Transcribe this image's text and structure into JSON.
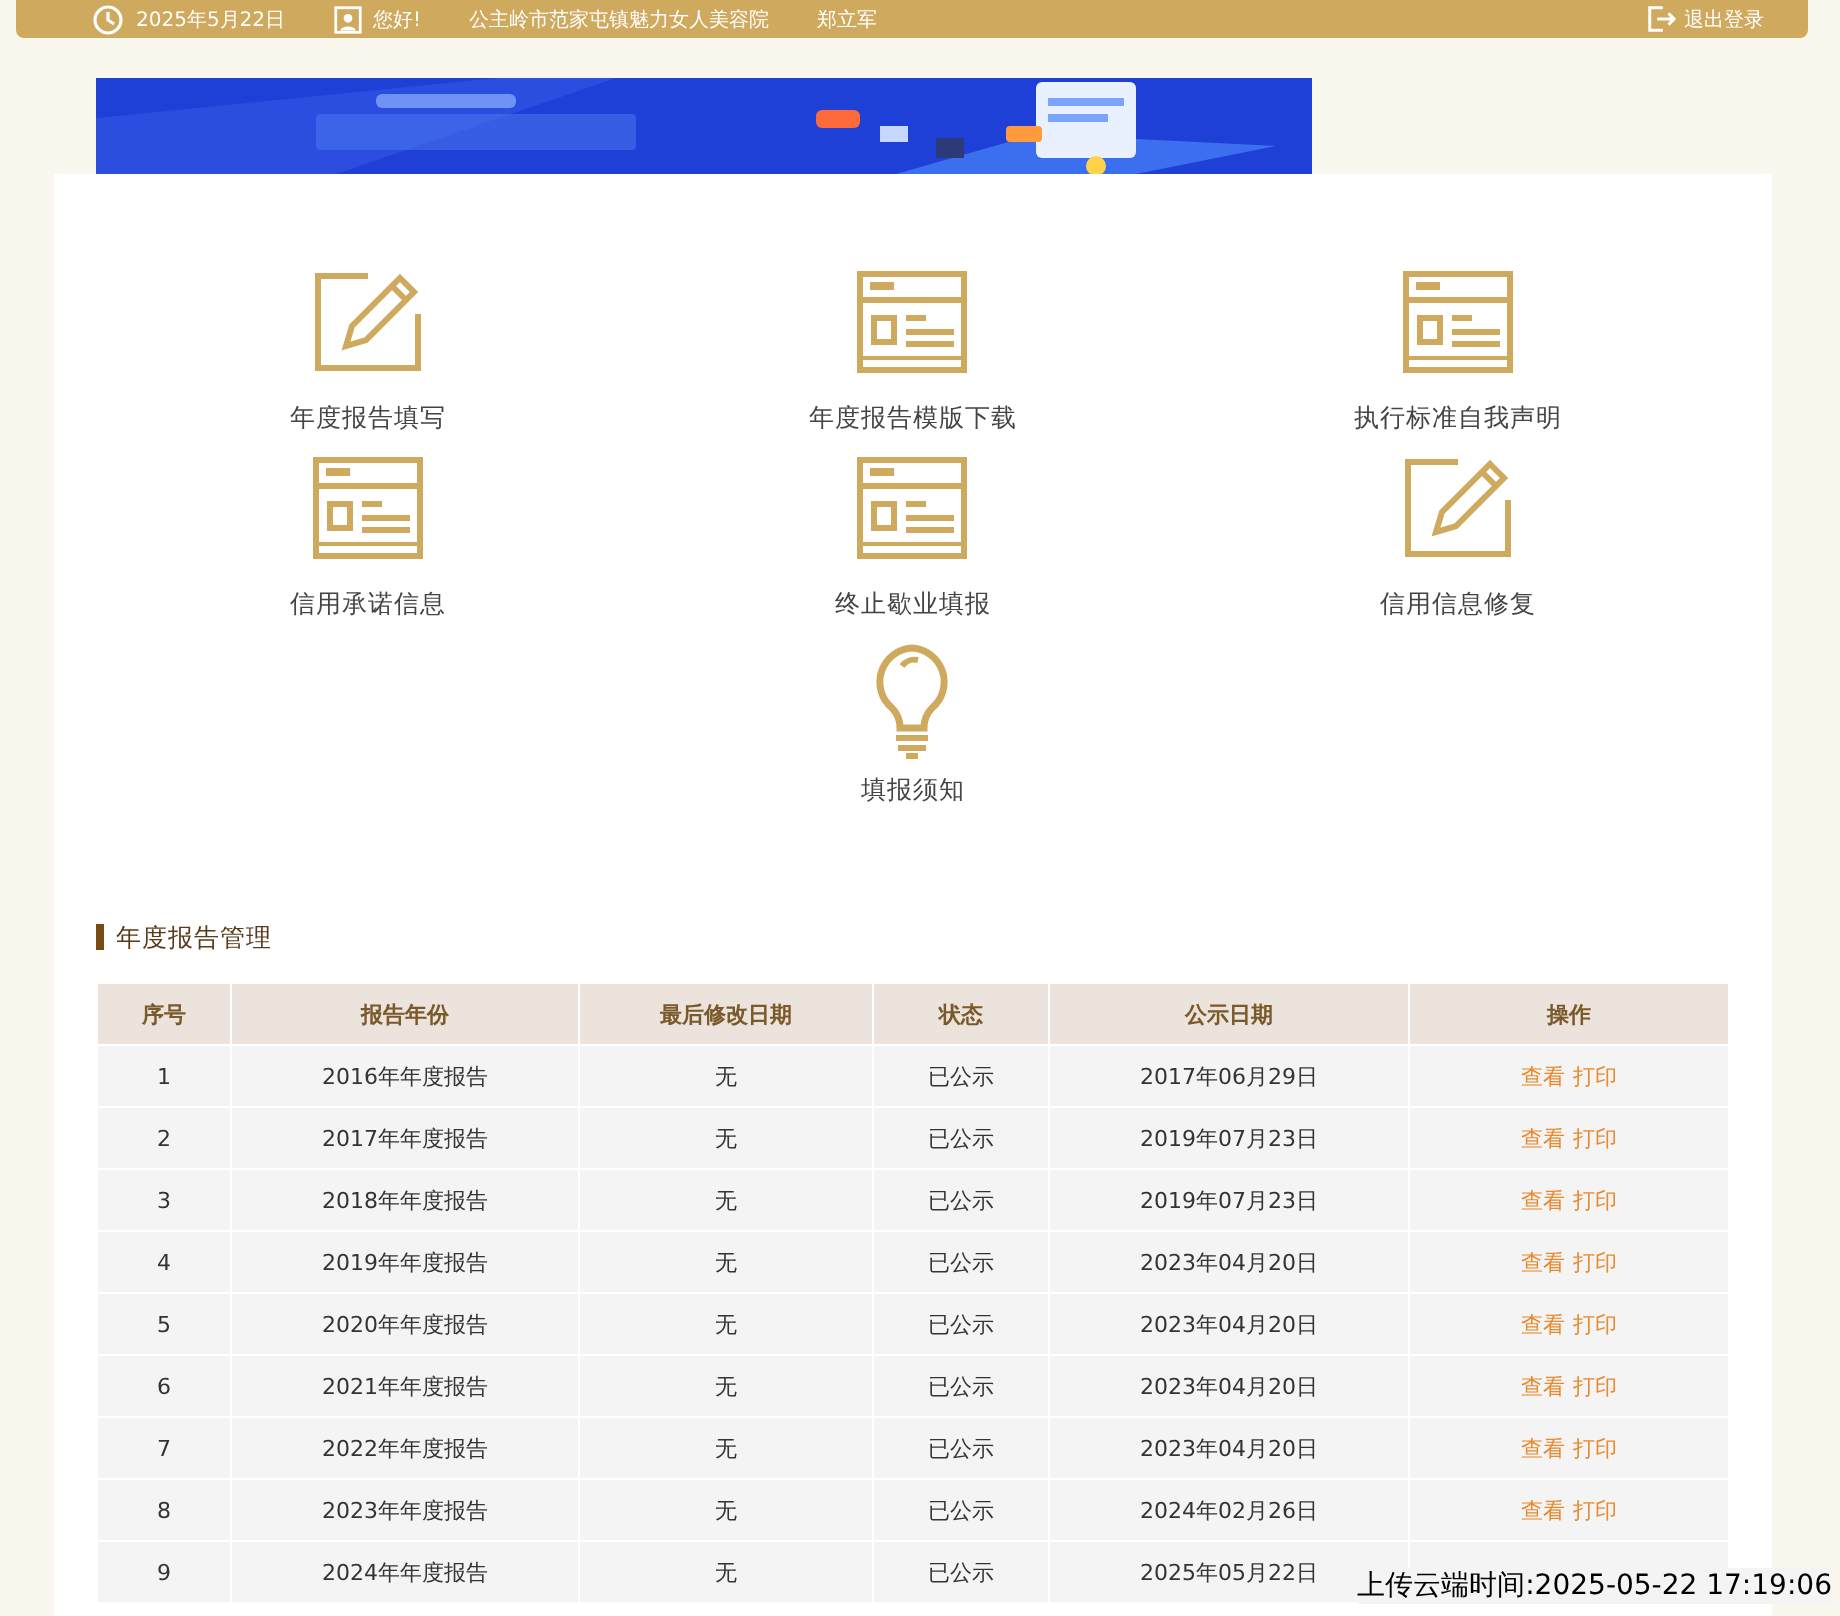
{
  "top_bar": {
    "date": "2025年5月22日",
    "greeting": "您好!",
    "company": "公主岭市范家屯镇魅力女人美容院",
    "user": "郑立军",
    "logout": "退出登录"
  },
  "shortcuts": [
    {
      "kind": "edit",
      "label": "年度报告填写"
    },
    {
      "kind": "form",
      "label": "年度报告模版下载"
    },
    {
      "kind": "form",
      "label": "执行标准自我声明"
    },
    {
      "kind": "form",
      "label": "信用承诺信息"
    },
    {
      "kind": "form",
      "label": "终止歇业填报"
    },
    {
      "kind": "edit",
      "label": "信用信息修复"
    },
    {
      "kind": "bulb",
      "label": "填报须知"
    }
  ],
  "section_title": "年度报告管理",
  "table": {
    "columns": [
      "序号",
      "报告年份",
      "最后修改日期",
      "状态",
      "公示日期",
      "操作"
    ],
    "rows": [
      {
        "cells": [
          "1",
          "2016年年度报告",
          "无",
          "已公示",
          "2017年06月29日"
        ],
        "actions": [
          "查看",
          "打印"
        ]
      },
      {
        "cells": [
          "2",
          "2017年年度报告",
          "无",
          "已公示",
          "2019年07月23日"
        ],
        "actions": [
          "查看",
          "打印"
        ]
      },
      {
        "cells": [
          "3",
          "2018年年度报告",
          "无",
          "已公示",
          "2019年07月23日"
        ],
        "actions": [
          "查看",
          "打印"
        ]
      },
      {
        "cells": [
          "4",
          "2019年年度报告",
          "无",
          "已公示",
          "2023年04月20日"
        ],
        "actions": [
          "查看",
          "打印"
        ]
      },
      {
        "cells": [
          "5",
          "2020年年度报告",
          "无",
          "已公示",
          "2023年04月20日"
        ],
        "actions": [
          "查看",
          "打印"
        ]
      },
      {
        "cells": [
          "6",
          "2021年年度报告",
          "无",
          "已公示",
          "2023年04月20日"
        ],
        "actions": [
          "查看",
          "打印"
        ]
      },
      {
        "cells": [
          "7",
          "2022年年度报告",
          "无",
          "已公示",
          "2023年04月20日"
        ],
        "actions": [
          "查看",
          "打印"
        ]
      },
      {
        "cells": [
          "8",
          "2023年年度报告",
          "无",
          "已公示",
          "2024年02月26日"
        ],
        "actions": [
          "查看",
          "打印"
        ]
      },
      {
        "cells": [
          "9",
          "2024年年度报告",
          "无",
          "已公示",
          "2025年05月22日"
        ],
        "actions": []
      }
    ]
  },
  "upload_time": "上传云端时间:2025-05-22 17:19:06"
}
